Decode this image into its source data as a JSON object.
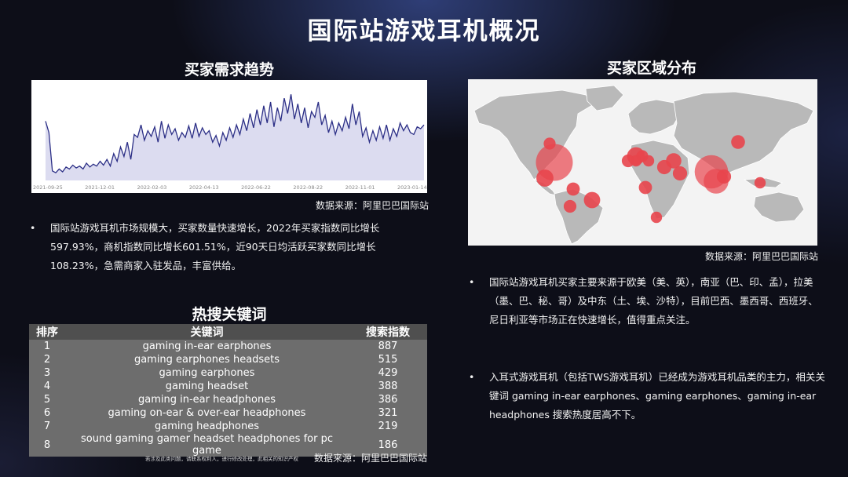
{
  "page": {
    "title": "国际站游戏耳机概况"
  },
  "trend": {
    "title": "买家需求趋势",
    "source": "数据来源：阿里巴巴国际站",
    "bullet": "国际站游戏耳机市场规模大，买家数量快速增长，2022年买家指数同比增长597.93%，商机指数同比增长601.51%，近90天日均活跃买家数同比增长108.23%，急需商家入驻发品，丰富供给。"
  },
  "region": {
    "title": "买家区域分布",
    "source": "数据来源：阿里巴巴国际站",
    "bullet1": "国际站游戏耳机买家主要来源于欧美（美、英），南亚（巴、印、孟），拉美（墨、巴、秘、哥）及中东（土、埃、沙特），目前巴西、墨西哥、西班牙、尼日利亚等市场正在快速增长，值得重点关注。",
    "bullet2": "入耳式游戏耳机（包括TWS游戏耳机）已经成为游戏耳机品类的主力，相关关键词 gaming in-ear earphones、gaming earphones、gaming in-ear headphones 搜索热度居高不下。"
  },
  "keywords": {
    "title": "热搜关键词",
    "headers": {
      "rank": "排序",
      "keyword": "关键词",
      "index": "搜索指数"
    },
    "rows": [
      {
        "rank": "1",
        "keyword": "gaming in-ear earphones",
        "index": "887"
      },
      {
        "rank": "2",
        "keyword": "gaming earphones headsets",
        "index": "515"
      },
      {
        "rank": "3",
        "keyword": "gaming earphones",
        "index": "429"
      },
      {
        "rank": "4",
        "keyword": "gaming headset",
        "index": "388"
      },
      {
        "rank": "5",
        "keyword": "gaming in-ear headphones",
        "index": "386"
      },
      {
        "rank": "6",
        "keyword": "gaming on-ear & over-ear headphones",
        "index": "321"
      },
      {
        "rank": "7",
        "keyword": "gaming headphones",
        "index": "219"
      },
      {
        "rank": "8",
        "keyword": "sound gaming gamer headset headphones for pc game",
        "index": "186"
      }
    ],
    "source": "数据来源：阿里巴巴国际站",
    "fineprint": "若涉及此类问题，请联系权利人，进行修改处理，此相关的知识产权"
  },
  "chart_data": {
    "type": "area",
    "title": "",
    "xlabel": "",
    "ylabel": "",
    "ylim": [
      0,
      100
    ],
    "grid": false,
    "ticks": [
      "2021-09-25",
      "2021-12-01",
      "2022-02-03",
      "2022-04-13",
      "2022-06-22",
      "2022-08-22",
      "2022-11-01",
      "2023-01-14"
    ],
    "series": [
      {
        "values": [
          62,
          50,
          10,
          8,
          12,
          9,
          14,
          12,
          16,
          13,
          15,
          12,
          18,
          14,
          17,
          15,
          20,
          16,
          22,
          15,
          28,
          20,
          35,
          25,
          40,
          22,
          48,
          45,
          58,
          42,
          52,
          46,
          56,
          40,
          62,
          44,
          58,
          48,
          54,
          42,
          50,
          45,
          57,
          44,
          60,
          46,
          55,
          48,
          52,
          40,
          47,
          36,
          50,
          42,
          55,
          45,
          58,
          48,
          64,
          52,
          70,
          55,
          74,
          58,
          78,
          60,
          82,
          56,
          76,
          62,
          86,
          70,
          90,
          64,
          80,
          60,
          76,
          55,
          72,
          66,
          82,
          58,
          68,
          50,
          62,
          48,
          60,
          52,
          66,
          54,
          80,
          58,
          72,
          46,
          55,
          40,
          52,
          42,
          56,
          44,
          58,
          42,
          54,
          46,
          60,
          52,
          58,
          50,
          48,
          56,
          54,
          58
        ]
      }
    ]
  },
  "map": {
    "colors": {
      "land": "#b9b9b9",
      "bubble": "#e8454d"
    },
    "bubbles": [
      {
        "name": "美国",
        "value": 100
      },
      {
        "name": "印度",
        "value": 80
      },
      {
        "name": "巴基斯坦",
        "value": 40
      },
      {
        "name": "英国",
        "value": 18
      },
      {
        "name": "墨西哥",
        "value": 16
      },
      {
        "name": "巴西",
        "value": 14
      },
      {
        "name": "土耳其",
        "value": 12
      },
      {
        "name": "埃及",
        "value": 10
      },
      {
        "name": "沙特",
        "value": 10
      },
      {
        "name": "孟加拉",
        "value": 10
      },
      {
        "name": "俄罗斯",
        "value": 9
      },
      {
        "name": "尼日利亚",
        "value": 8
      },
      {
        "name": "哥伦比亚",
        "value": 8
      },
      {
        "name": "秘鲁",
        "value": 7
      },
      {
        "name": "西班牙",
        "value": 7
      },
      {
        "name": "德国",
        "value": 6
      },
      {
        "name": "加拿大",
        "value": 6
      },
      {
        "name": "南非",
        "value": 5
      },
      {
        "name": "印尼",
        "value": 5
      },
      {
        "name": "意大利",
        "value": 5
      },
      {
        "name": "法国",
        "value": 5
      }
    ]
  }
}
